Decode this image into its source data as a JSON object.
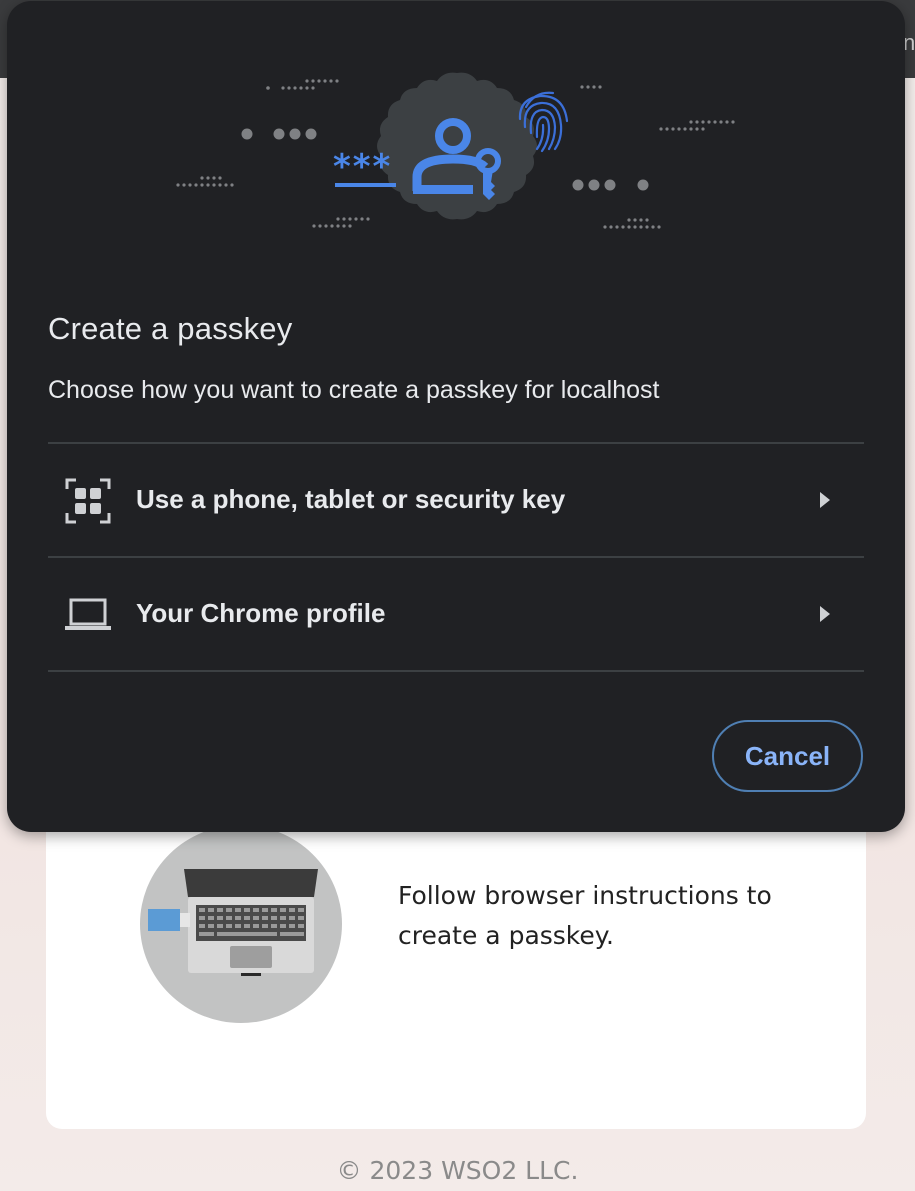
{
  "browser": {
    "topbar_text": "n"
  },
  "dialog": {
    "title": "Create a passkey",
    "subtitle": "Choose how you want to create a passkey for localhost",
    "hero": {
      "asterisks": "***"
    },
    "options": [
      {
        "label": "Use a phone, tablet or security key",
        "icon": "qr-code-icon"
      },
      {
        "label": "Your Chrome profile",
        "icon": "laptop-icon"
      }
    ],
    "cancel_label": "Cancel"
  },
  "page": {
    "instructions": "Follow browser instructions to create a passkey.",
    "copyright": "© 2023 WSO2 LLC."
  },
  "colors": {
    "dialog_bg": "#202124",
    "accent_blue": "#8ab4f8",
    "hero_blue": "#4a86e8",
    "divider": "#3c4043",
    "usb_blue": "#5b9bd5"
  }
}
